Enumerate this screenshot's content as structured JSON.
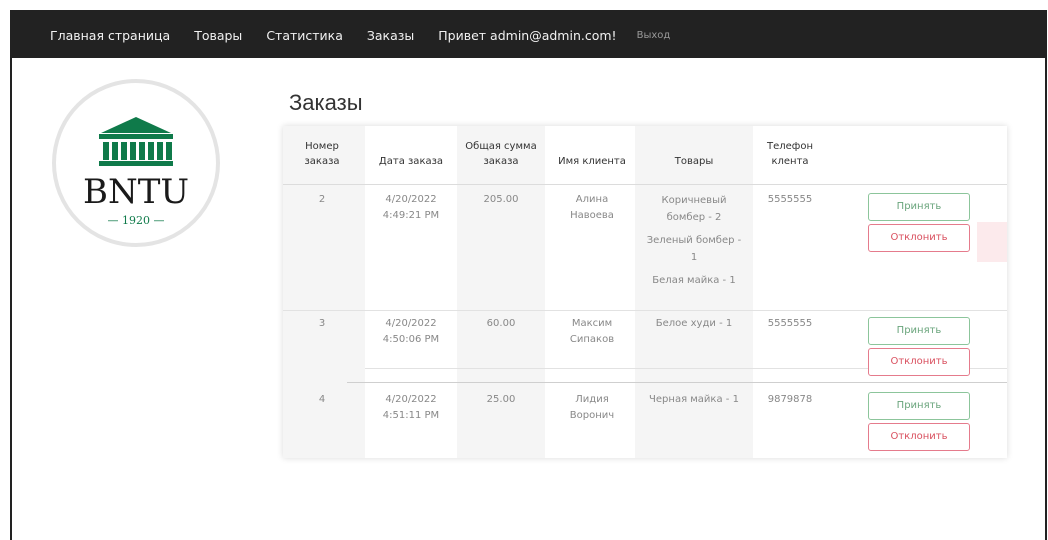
{
  "nav": {
    "home": "Главная страница",
    "products": "Товары",
    "stats": "Статистика",
    "orders": "Заказы",
    "greeting": "Привет admin@admin.com!",
    "logout": "Выход"
  },
  "logo": {
    "name": "BNTU",
    "year": "— 1920 —",
    "color": "#0f7a4a"
  },
  "page": {
    "title": "Заказы"
  },
  "table": {
    "headers": {
      "number": [
        "Номер",
        "заказа"
      ],
      "date": [
        "Дата заказа"
      ],
      "sum": [
        "Общая сумма",
        "заказа"
      ],
      "client": [
        "Имя клиента"
      ],
      "goods": [
        "Товары"
      ],
      "phone": [
        "Телефон",
        "клента"
      ]
    },
    "rows": [
      {
        "number": "2",
        "date": [
          "4/20/2022",
          "4:49:21 PM"
        ],
        "sum": "205.00",
        "client": [
          "Алина",
          "Навоева"
        ],
        "goods": [
          "Коричневый",
          "бомбер - 2",
          "Зеленый бомбер -",
          "1",
          "Белая майка - 1"
        ],
        "phone": "5555555",
        "accept": "Принять",
        "reject": "Отклонить"
      },
      {
        "number": "3",
        "date": [
          "4/20/2022",
          "4:50:06 PM"
        ],
        "sum": "60.00",
        "client": [
          "Максим",
          "Сипаков"
        ],
        "goods": [
          "Белое худи - 1"
        ],
        "phone": "5555555",
        "accept": "Принять",
        "reject": "Отклонить"
      },
      {
        "number": "4",
        "date": [
          "4/20/2022",
          "4:51:11 PM"
        ],
        "sum": "25.00",
        "client": [
          "Лидия",
          "Воронич"
        ],
        "goods": [
          "Черная майка - 1"
        ],
        "phone": "9879878",
        "accept": "Принять",
        "reject": "Отклонить"
      }
    ]
  }
}
